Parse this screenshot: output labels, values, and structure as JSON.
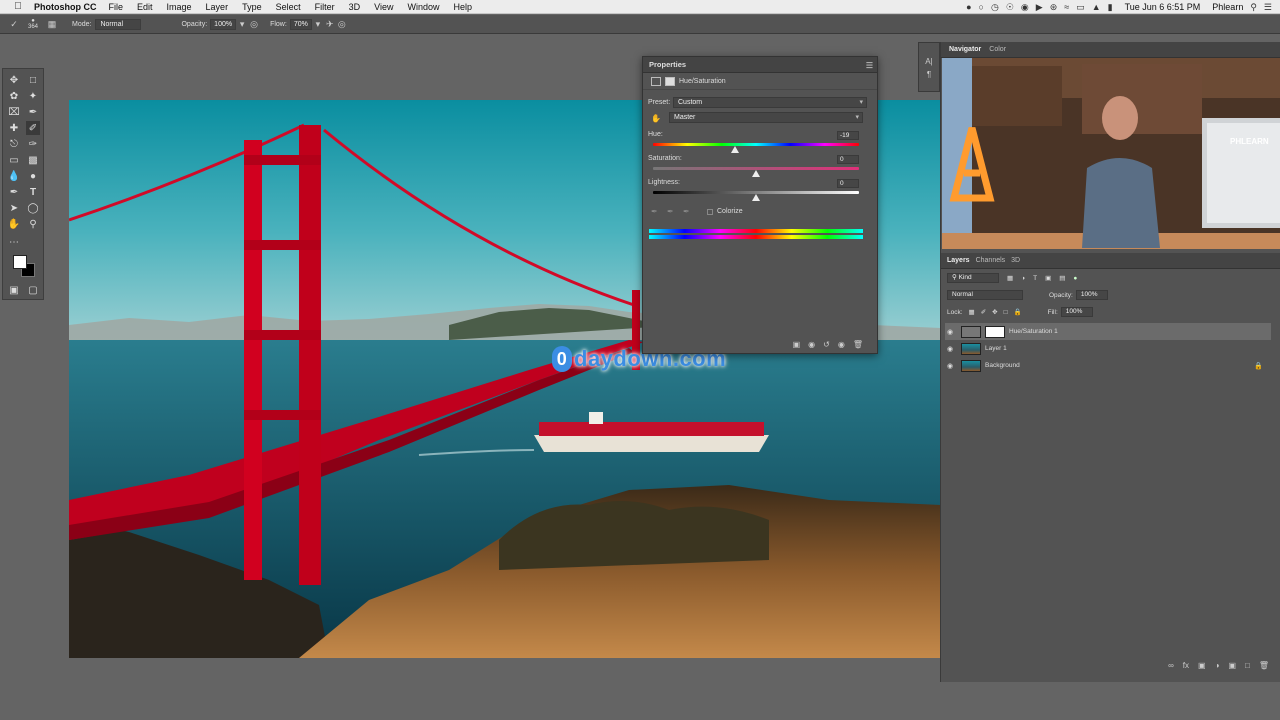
{
  "menubar": {
    "app": "Photoshop CC",
    "items": [
      "File",
      "Edit",
      "Image",
      "Layer",
      "Type",
      "Select",
      "Filter",
      "3D",
      "View",
      "Window",
      "Help"
    ],
    "clock": "Tue Jun 6  6:51 PM",
    "user": "Phlearn"
  },
  "options": {
    "brush_size": "364",
    "mode_label": "Mode:",
    "mode_value": "Normal",
    "opacity_label": "Opacity:",
    "opacity_value": "100%",
    "flow_label": "Flow:",
    "flow_value": "70%"
  },
  "properties": {
    "title": "Properties",
    "adjustment": "Hue/Saturation",
    "preset_label": "Preset:",
    "preset_value": "Custom",
    "channel": "Master",
    "hue_label": "Hue:",
    "hue_value": "-19",
    "hue_level": 0.4,
    "saturation_label": "Saturation:",
    "saturation_value": "0",
    "saturation_level": 0.5,
    "lightness_label": "Lightness:",
    "lightness_value": "0",
    "lightness_level": 0.5,
    "colorize_label": "Colorize"
  },
  "watermark": {
    "badge": "0",
    "text": "daydown.com"
  },
  "dock": {
    "tab_navigator": "Navigator",
    "tab_color": "Color",
    "nav_sign": "PHLEARN",
    "tab_layers": "Layers",
    "tab_channels": "Channels",
    "tab_3d": "3D",
    "kind_label": "Kind",
    "blend_mode": "Normal",
    "opacity_label": "Opacity:",
    "opacity_value": "100%",
    "lock_label": "Lock:",
    "fill_label": "Fill:",
    "fill_value": "100%",
    "layers": [
      {
        "name": "Hue/Saturation 1"
      },
      {
        "name": "Layer 1"
      },
      {
        "name": "Background"
      }
    ]
  }
}
